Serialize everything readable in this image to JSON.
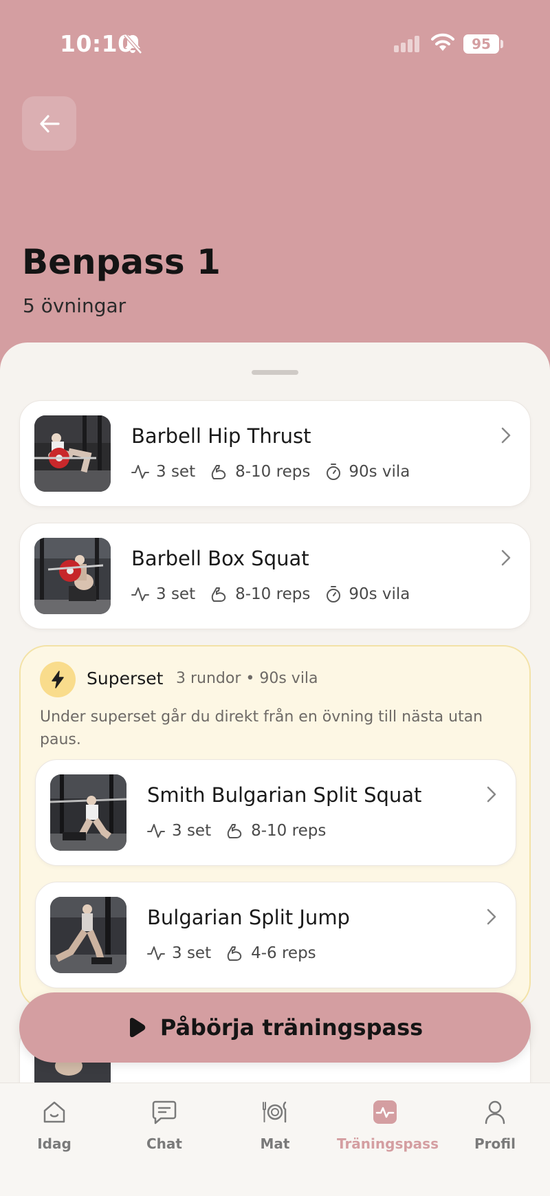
{
  "status_bar": {
    "time": "10:10",
    "battery": "95"
  },
  "header": {
    "title": "Benpass 1",
    "subtitle": "5 övningar"
  },
  "exercises": [
    {
      "name": "Barbell Hip Thrust",
      "sets": "3 set",
      "reps": "8-10 reps",
      "rest": "90s vila"
    },
    {
      "name": "Barbell Box Squat",
      "sets": "3 set",
      "reps": "8-10 reps",
      "rest": "90s vila"
    }
  ],
  "superset": {
    "title": "Superset",
    "meta": "3 rundor • 90s vila",
    "description": "Under superset går du direkt från en övning till nästa utan paus.",
    "exercises": [
      {
        "name": "Smith Bulgarian Split Squat",
        "sets": "3 set",
        "reps": "8-10 reps"
      },
      {
        "name": "Bulgarian Split Jump",
        "sets": "3 set",
        "reps": "4-6 reps"
      }
    ]
  },
  "start_button": {
    "label": "Påbörja träningspass"
  },
  "tabs": [
    {
      "label": "Idag",
      "icon": "home-icon"
    },
    {
      "label": "Chat",
      "icon": "chat-icon"
    },
    {
      "label": "Mat",
      "icon": "food-icon"
    },
    {
      "label": "Träningspass",
      "icon": "activity-icon",
      "active": true
    },
    {
      "label": "Profil",
      "icon": "profile-icon"
    }
  ],
  "colors": {
    "brand": "#d49ea1",
    "sheet": "#f6f3ef",
    "superset_bg": "#fdf7e4",
    "bolt": "#f9dc8c"
  }
}
